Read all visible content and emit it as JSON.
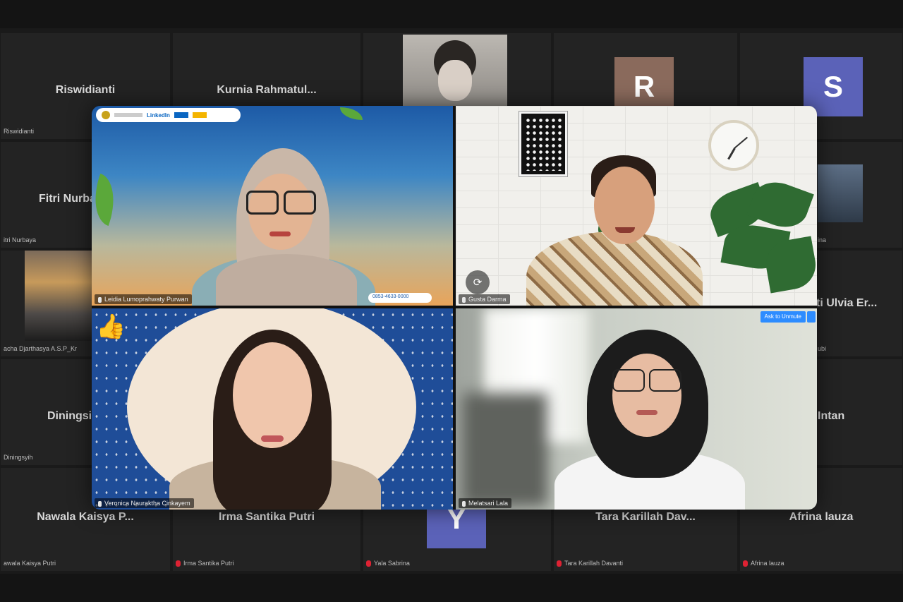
{
  "background_tiles": [
    {
      "name": "Riswidianti",
      "footer": "Riswidianti"
    },
    {
      "name": "Kurnia  Rahmatul...",
      "footer": ""
    },
    {
      "name": "",
      "footer": ""
    },
    {
      "name": "",
      "footer": "",
      "avatar": "R"
    },
    {
      "name": "",
      "footer": "",
      "avatar": "S"
    },
    {
      "name": "Fitri Nurba",
      "footer": "itri Nurbaya"
    },
    {
      "name": "",
      "footer": "acha Djarthasya A.S.P_Kr"
    },
    {
      "name": "ti Ulvia Er...",
      "footer": "ubi"
    },
    {
      "name": "Diningsi",
      "footer": "Diningsyih"
    },
    {
      "name": "Intan",
      "footer": ""
    },
    {
      "name": "Nawala Kaisya P...",
      "footer": "awala Kaisya Putri"
    },
    {
      "name": "Irma Santika Putri",
      "footer": "Irma Santika Putri"
    },
    {
      "name": "",
      "footer": "Yala Sabrina",
      "avatar": "Y"
    },
    {
      "name": "Tara Karillah Dav...",
      "footer": "Tara Karillah Davanti"
    },
    {
      "name": "Afrina lauza",
      "footer": "Afrina lauza"
    },
    {
      "name": "",
      "footer": "ina"
    }
  ],
  "feeds": {
    "top_left": {
      "name_tag": "Leidia Lumoprahwaty Purwan",
      "sponsor": "LinkedIn",
      "contact": "0853-4633-0000"
    },
    "top_right": {
      "name_tag": "Gusta Darma"
    },
    "bottom_left": {
      "name_tag": "Veronica Nauraktha Cinkayem"
    },
    "bottom_right": {
      "name_tag": "Melatsari Lala",
      "ask_button": "Ask to Unmute"
    }
  },
  "colors": {
    "accent": "#2d8cff",
    "muted_mic": "#dd2233"
  },
  "icons": {
    "thumbs_up": "👍",
    "camera_switch": "⟳"
  }
}
